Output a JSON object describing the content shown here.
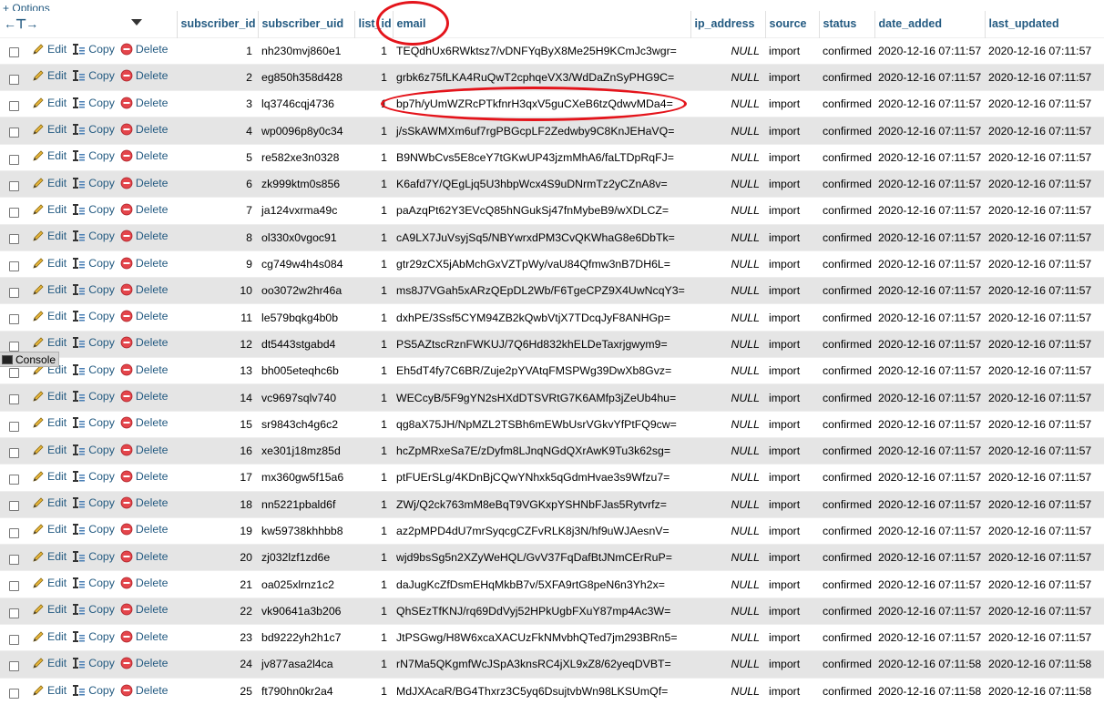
{
  "options_label": "Options",
  "options_prefix": "+",
  "nav_arrows": "←⊤→",
  "columns": {
    "subscriber_id": "subscriber_id",
    "subscriber_uid": "subscriber_uid",
    "list_id": "list_id",
    "email": "email",
    "ip_address": "ip_address",
    "source": "source",
    "status": "status",
    "date_added": "date_added",
    "last_updated": "last_updated"
  },
  "actions": {
    "edit": "Edit",
    "copy": "Copy",
    "delete": "Delete"
  },
  "console_label": "Console",
  "rows": [
    {
      "id": "1",
      "uid": "nh230mvj860e1",
      "list": "1",
      "email": "TEQdhUx6RWktsz7/vDNFYqByX8Me25H9KCmJc3wgr=",
      "ip": "NULL",
      "source": "import",
      "status": "confirmed",
      "added": "2020-12-16 07:11:57",
      "updated": "2020-12-16 07:11:57"
    },
    {
      "id": "2",
      "uid": "eg850h358d428",
      "list": "1",
      "email": "grbk6z75fLKA4RuQwT2cphqeVX3/WdDaZnSyPHG9C=",
      "ip": "NULL",
      "source": "import",
      "status": "confirmed",
      "added": "2020-12-16 07:11:57",
      "updated": "2020-12-16 07:11:57"
    },
    {
      "id": "3",
      "uid": "lq3746cqj4736",
      "list": "1",
      "email": "bp7h/yUmWZRcPTkfnrH3qxV5guCXeB6tzQdwvMDa4=",
      "ip": "NULL",
      "source": "import",
      "status": "confirmed",
      "added": "2020-12-16 07:11:57",
      "updated": "2020-12-16 07:11:57"
    },
    {
      "id": "4",
      "uid": "wp0096p8y0c34",
      "list": "1",
      "email": "j/sSkAWMXm6uf7rgPBGcpLF2Zedwby9C8KnJEHaVQ=",
      "ip": "NULL",
      "source": "import",
      "status": "confirmed",
      "added": "2020-12-16 07:11:57",
      "updated": "2020-12-16 07:11:57"
    },
    {
      "id": "5",
      "uid": "re582xe3n0328",
      "list": "1",
      "email": "B9NWbCvs5E8ceY7tGKwUP43jzmMhA6/faLTDpRqFJ=",
      "ip": "NULL",
      "source": "import",
      "status": "confirmed",
      "added": "2020-12-16 07:11:57",
      "updated": "2020-12-16 07:11:57"
    },
    {
      "id": "6",
      "uid": "zk999ktm0s856",
      "list": "1",
      "email": "K6afd7Y/QEgLjq5U3hbpWcx4S9uDNrmTz2yCZnA8v=",
      "ip": "NULL",
      "source": "import",
      "status": "confirmed",
      "added": "2020-12-16 07:11:57",
      "updated": "2020-12-16 07:11:57"
    },
    {
      "id": "7",
      "uid": "ja124vxrma49c",
      "list": "1",
      "email": "paAzqPt62Y3EVcQ85hNGukSj47fnMybeB9/wXDLCZ=",
      "ip": "NULL",
      "source": "import",
      "status": "confirmed",
      "added": "2020-12-16 07:11:57",
      "updated": "2020-12-16 07:11:57"
    },
    {
      "id": "8",
      "uid": "ol330x0vgoc91",
      "list": "1",
      "email": "cA9LX7JuVsyjSq5/NBYwrxdPM3CvQKWhaG8e6DbTk=",
      "ip": "NULL",
      "source": "import",
      "status": "confirmed",
      "added": "2020-12-16 07:11:57",
      "updated": "2020-12-16 07:11:57"
    },
    {
      "id": "9",
      "uid": "cg749w4h4s084",
      "list": "1",
      "email": "gtr29zCX5jAbMchGxVZTpWy/vaU84Qfmw3nB7DH6L=",
      "ip": "NULL",
      "source": "import",
      "status": "confirmed",
      "added": "2020-12-16 07:11:57",
      "updated": "2020-12-16 07:11:57"
    },
    {
      "id": "10",
      "uid": "oo3072w2hr46a",
      "list": "1",
      "email": "ms8J7VGah5xARzQEpDL2Wb/F6TgeCPZ9X4UwNcqY3=",
      "ip": "NULL",
      "source": "import",
      "status": "confirmed",
      "added": "2020-12-16 07:11:57",
      "updated": "2020-12-16 07:11:57"
    },
    {
      "id": "11",
      "uid": "le579bqkg4b0b",
      "list": "1",
      "email": "dxhPE/3Ssf5CYM94ZB2kQwbVtjX7TDcqJyF8ANHGp=",
      "ip": "NULL",
      "source": "import",
      "status": "confirmed",
      "added": "2020-12-16 07:11:57",
      "updated": "2020-12-16 07:11:57"
    },
    {
      "id": "12",
      "uid": "dt5443stgabd4",
      "list": "1",
      "email": "PS5AZtscRznFWKUJ/7Q6Hd832khELDeTaxrjgwym9=",
      "ip": "NULL",
      "source": "import",
      "status": "confirmed",
      "added": "2020-12-16 07:11:57",
      "updated": "2020-12-16 07:11:57"
    },
    {
      "id": "13",
      "uid": "bh005eteqhc6b",
      "list": "1",
      "email": "Eh5dT4fy7C6BR/Zuje2pYVAtqFMSPWg39DwXb8Gvz=",
      "ip": "NULL",
      "source": "import",
      "status": "confirmed",
      "added": "2020-12-16 07:11:57",
      "updated": "2020-12-16 07:11:57"
    },
    {
      "id": "14",
      "uid": "vc9697sqlv740",
      "list": "1",
      "email": "WECcyB/5F9gYN2sHXdDTSVRtG7K6AMfp3jZeUb4hu=",
      "ip": "NULL",
      "source": "import",
      "status": "confirmed",
      "added": "2020-12-16 07:11:57",
      "updated": "2020-12-16 07:11:57"
    },
    {
      "id": "15",
      "uid": "sr9843ch4g6c2",
      "list": "1",
      "email": "qg8aX75JH/NpMZL2TSBh6mEWbUsrVGkvYfPtFQ9cw=",
      "ip": "NULL",
      "source": "import",
      "status": "confirmed",
      "added": "2020-12-16 07:11:57",
      "updated": "2020-12-16 07:11:57"
    },
    {
      "id": "16",
      "uid": "xe301j18mz85d",
      "list": "1",
      "email": "hcZpMRxeSa7E/zDyfm8LJnqNGdQXrAwK9Tu3k62sg=",
      "ip": "NULL",
      "source": "import",
      "status": "confirmed",
      "added": "2020-12-16 07:11:57",
      "updated": "2020-12-16 07:11:57"
    },
    {
      "id": "17",
      "uid": "mx360gw5f15a6",
      "list": "1",
      "email": "ptFUErSLg/4KDnBjCQwYNhxk5qGdmHvae3s9Wfzu7=",
      "ip": "NULL",
      "source": "import",
      "status": "confirmed",
      "added": "2020-12-16 07:11:57",
      "updated": "2020-12-16 07:11:57"
    },
    {
      "id": "18",
      "uid": "nn5221pbald6f",
      "list": "1",
      "email": "ZWj/Q2ck763mM8eBqT9VGKxpYSHNbFJas5Rytvrfz=",
      "ip": "NULL",
      "source": "import",
      "status": "confirmed",
      "added": "2020-12-16 07:11:57",
      "updated": "2020-12-16 07:11:57"
    },
    {
      "id": "19",
      "uid": "kw59738khhbb8",
      "list": "1",
      "email": "az2pMPD4dU7mrSyqcgCZFvRLK8j3N/hf9uWJAesnV=",
      "ip": "NULL",
      "source": "import",
      "status": "confirmed",
      "added": "2020-12-16 07:11:57",
      "updated": "2020-12-16 07:11:57"
    },
    {
      "id": "20",
      "uid": "zj032lzf1zd6e",
      "list": "1",
      "email": "wjd9bsSg5n2XZyWeHQL/GvV37FqDafBtJNmCErRuP=",
      "ip": "NULL",
      "source": "import",
      "status": "confirmed",
      "added": "2020-12-16 07:11:57",
      "updated": "2020-12-16 07:11:57"
    },
    {
      "id": "21",
      "uid": "oa025xlrnz1c2",
      "list": "1",
      "email": "daJugKcZfDsmEHqMkbB7v/5XFA9rtG8peN6n3Yh2x=",
      "ip": "NULL",
      "source": "import",
      "status": "confirmed",
      "added": "2020-12-16 07:11:57",
      "updated": "2020-12-16 07:11:57"
    },
    {
      "id": "22",
      "uid": "vk90641a3b206",
      "list": "1",
      "email": "QhSEzTfKNJ/rq69DdVyj52HPkUgbFXuY87mp4Ac3W=",
      "ip": "NULL",
      "source": "import",
      "status": "confirmed",
      "added": "2020-12-16 07:11:57",
      "updated": "2020-12-16 07:11:57"
    },
    {
      "id": "23",
      "uid": "bd9222yh2h1c7",
      "list": "1",
      "email": "JtPSGwg/H8W6xcaXACUzFkNMvbhQTed7jm293BRn5=",
      "ip": "NULL",
      "source": "import",
      "status": "confirmed",
      "added": "2020-12-16 07:11:57",
      "updated": "2020-12-16 07:11:57"
    },
    {
      "id": "24",
      "uid": "jv877asa2l4ca",
      "list": "1",
      "email": "rN7Ma5QKgmfWcJSpA3knsRC4jXL9xZ8/62yeqDVBT=",
      "ip": "NULL",
      "source": "import",
      "status": "confirmed",
      "added": "2020-12-16 07:11:58",
      "updated": "2020-12-16 07:11:58"
    },
    {
      "id": "25",
      "uid": "ft790hn0kr2a4",
      "list": "1",
      "email": "MdJXAcaR/BG4Thxrz3C5yq6DsujtvbWn98LKSUmQf=",
      "ip": "NULL",
      "source": "import",
      "status": "confirmed",
      "added": "2020-12-16 07:11:58",
      "updated": "2020-12-16 07:11:58"
    }
  ],
  "colors": {
    "link": "#235a81",
    "annotation": "#e4141b",
    "row_alt": "#e5e5e5"
  }
}
